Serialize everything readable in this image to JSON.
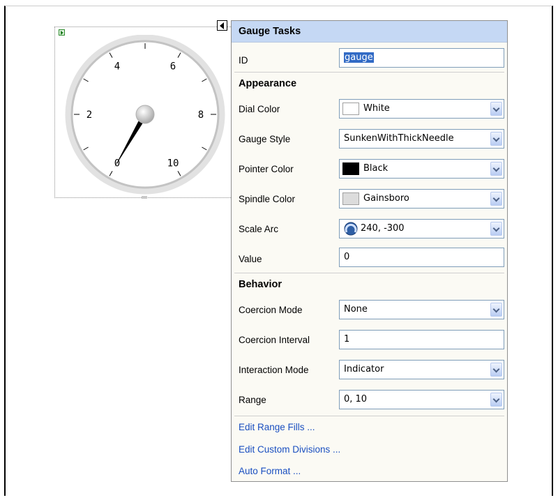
{
  "gauge": {
    "scale_labels": [
      "0",
      "2",
      "4",
      "6",
      "8",
      "10"
    ],
    "value": 0,
    "range": [
      0,
      10
    ],
    "arc_start_deg": 240,
    "arc_sweep_deg": -300
  },
  "panel": {
    "title": "Gauge Tasks",
    "id_label": "ID",
    "id_value": "gauge",
    "appearance": {
      "section_title": "Appearance",
      "dial_color": {
        "label": "Dial Color",
        "value": "White",
        "swatch": "#ffffff"
      },
      "gauge_style": {
        "label": "Gauge Style",
        "value": "SunkenWithThickNeedle"
      },
      "pointer_color": {
        "label": "Pointer Color",
        "value": "Black",
        "swatch": "#000000"
      },
      "spindle_color": {
        "label": "Spindle Color",
        "value": "Gainsboro",
        "swatch": "#dcdcdc"
      },
      "scale_arc": {
        "label": "Scale Arc",
        "value": "240, -300"
      },
      "value": {
        "label": "Value",
        "value": "0"
      }
    },
    "behavior": {
      "section_title": "Behavior",
      "coercion_mode": {
        "label": "Coercion Mode",
        "value": "None"
      },
      "coercion_interval": {
        "label": "Coercion Interval",
        "value": "1"
      },
      "interaction_mode": {
        "label": "Interaction Mode",
        "value": "Indicator"
      },
      "range": {
        "label": "Range",
        "value": "0, 10"
      }
    },
    "links": {
      "edit_range_fills": "Edit Range Fills ...",
      "edit_custom_divisions": "Edit Custom Divisions ...",
      "auto_format": "Auto Format ..."
    }
  },
  "colors": {
    "header_bg": "#c5d8f4",
    "link": "#1a4fc0",
    "selection": "#316ac5"
  }
}
